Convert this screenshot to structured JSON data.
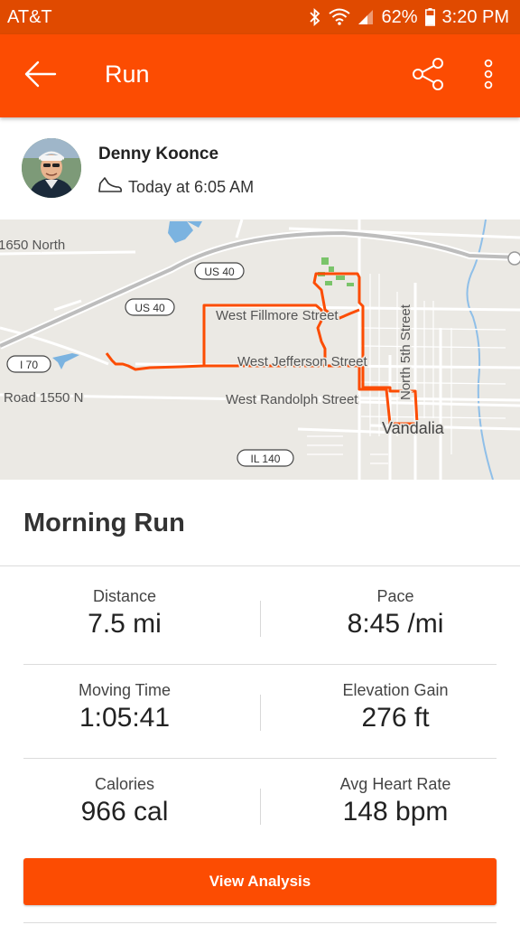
{
  "status_bar": {
    "carrier": "AT&T",
    "battery": "62%",
    "time": "3:20 PM",
    "icons": [
      "bluetooth-icon",
      "wifi-icon",
      "signal-icon",
      "battery-icon"
    ]
  },
  "app_bar": {
    "title": "Run",
    "back_icon": "arrow-left-icon",
    "share_icon": "share-icon",
    "more_icon": "more-vertical-icon",
    "color": "#fc4c02"
  },
  "athlete": {
    "name": "Denny Koonce",
    "time": "Today at 6:05 AM",
    "activity_icon": "shoe-icon"
  },
  "map": {
    "route_color": "#fc4c02",
    "labels": {
      "road_1650": "1650 North",
      "us40_a": "US 40",
      "us40_b": "US 40",
      "i70": "I 70",
      "road_1550": "Road 1550 N",
      "fillmore": "West Fillmore Street",
      "jefferson": "West Jefferson Street",
      "randolph": "West Randolph Street",
      "fifth": "North 5th Street",
      "city": "Vandalia",
      "il140": "IL 140"
    }
  },
  "activity": {
    "title": "Morning Run"
  },
  "stats": [
    {
      "label": "Distance",
      "value": "7.5 mi"
    },
    {
      "label": "Pace",
      "value": "8:45 /mi"
    },
    {
      "label": "Moving Time",
      "value": "1:05:41"
    },
    {
      "label": "Elevation Gain",
      "value": "276 ft"
    },
    {
      "label": "Calories",
      "value": "966 cal"
    },
    {
      "label": "Avg Heart Rate",
      "value": "148 bpm"
    }
  ],
  "actions": {
    "view_analysis": "View Analysis"
  }
}
